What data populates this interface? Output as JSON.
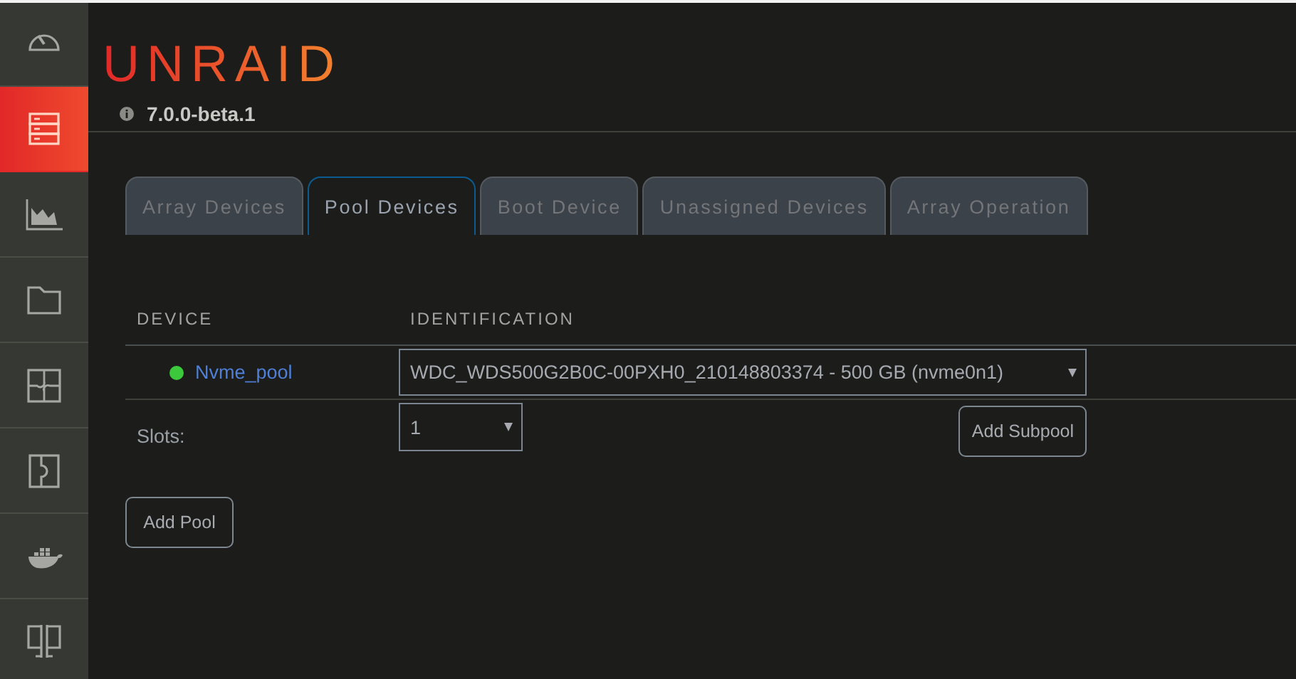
{
  "sidebar": {
    "items": [
      {
        "kind": "gauge",
        "selected": false
      },
      {
        "kind": "server",
        "selected": true
      },
      {
        "kind": "chart",
        "selected": false
      },
      {
        "kind": "folder",
        "selected": false
      },
      {
        "kind": "puzzle",
        "selected": false
      },
      {
        "kind": "plug",
        "selected": false
      },
      {
        "kind": "whale",
        "selected": false
      },
      {
        "kind": "monitors",
        "selected": false
      }
    ]
  },
  "header": {
    "logo": "UNRAID",
    "version": "7.0.0-beta.1"
  },
  "tabs": [
    {
      "label": "Array Devices",
      "selected": false
    },
    {
      "label": "Pool Devices",
      "selected": true
    },
    {
      "label": "Boot Device",
      "selected": false
    },
    {
      "label": "Unassigned Devices",
      "selected": false
    },
    {
      "label": "Array Operation",
      "selected": false
    }
  ],
  "table": {
    "columns": [
      "DEVICE",
      "IDENTIFICATION"
    ],
    "rows": [
      {
        "device": "Nvme_pool",
        "color": "#3cc93c",
        "identification": "WDC_WDS500G2B0C-00PXH0_210148803374 - 500 GB (nvme0n1)"
      }
    ]
  },
  "slots": {
    "label": "Slots:",
    "value": "1"
  },
  "buttons": {
    "add_subpool": "Add Subpool",
    "add_pool": "Add Pool"
  }
}
